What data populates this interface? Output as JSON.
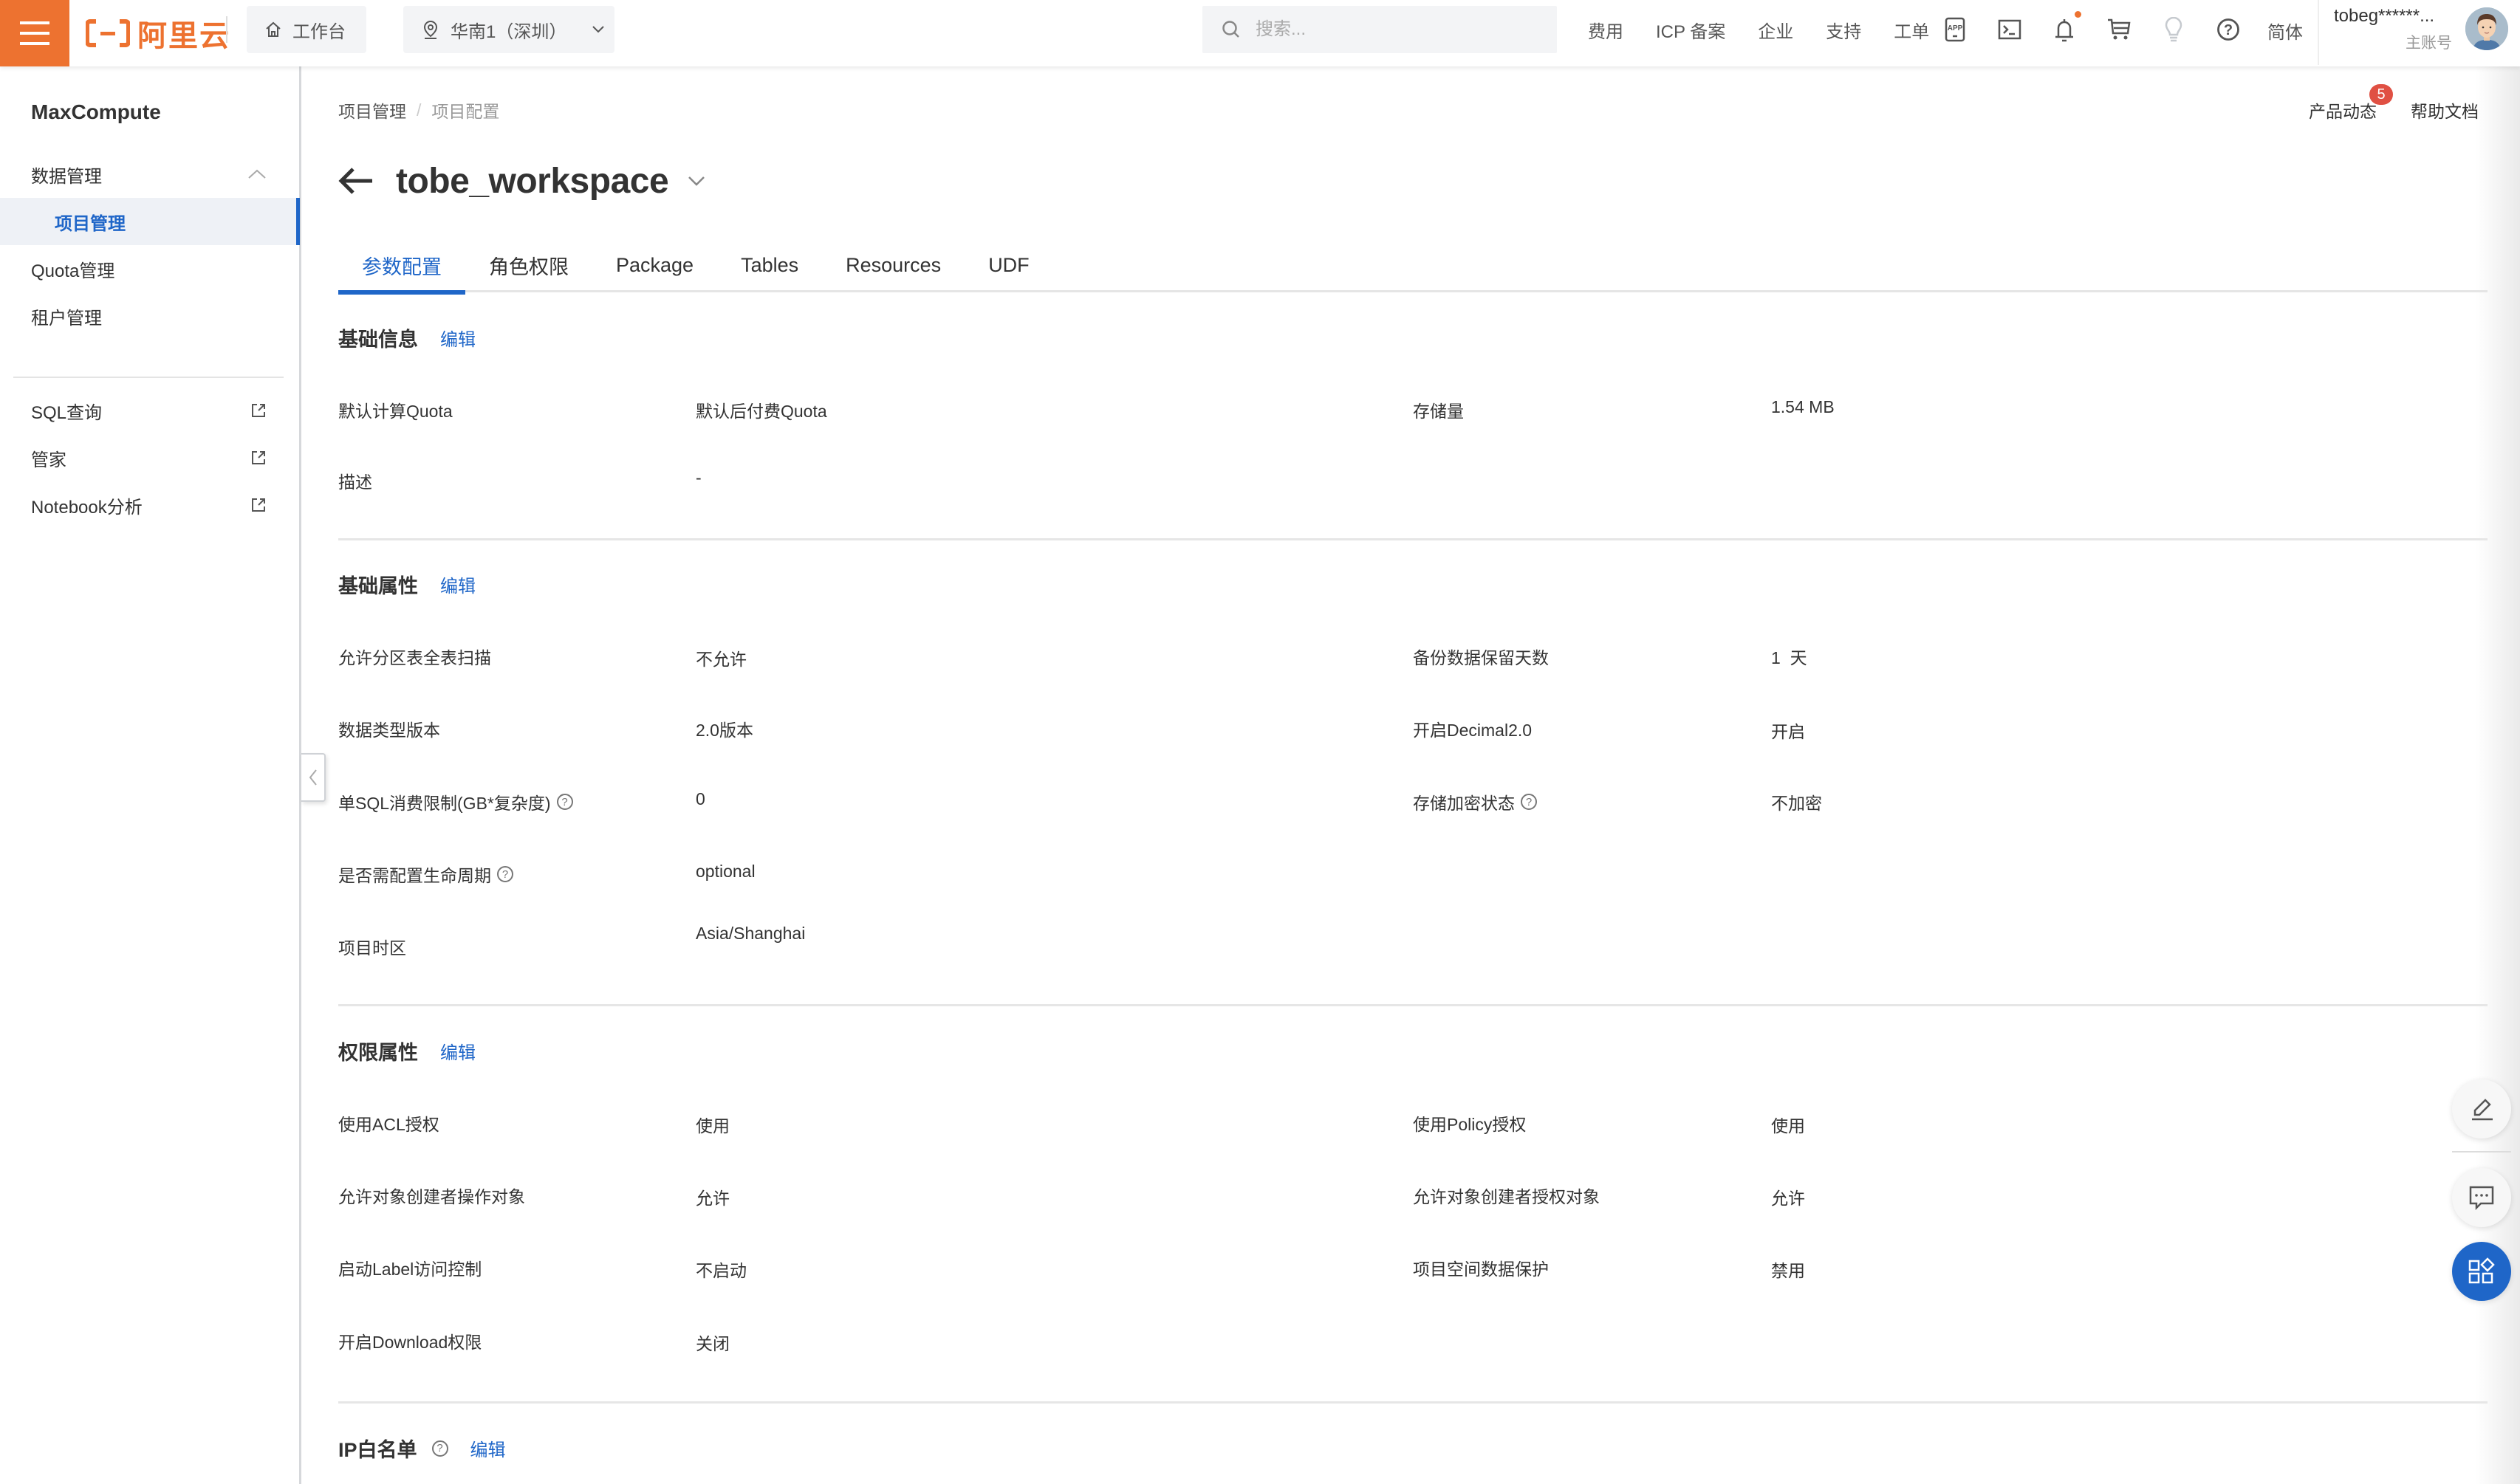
{
  "topbar": {
    "logo_text": "阿里云",
    "workbench_label": "工作台",
    "region_label": "华南1（深圳）",
    "search_placeholder": "搜索...",
    "nav_links": [
      "费用",
      "ICP 备案",
      "企业",
      "支持",
      "工单"
    ],
    "nav_icons": [
      "app-icon",
      "terminal-icon",
      "bell-icon",
      "cart-icon",
      "lightbulb-icon",
      "help-icon"
    ],
    "notification_dot": true,
    "language_label": "简体",
    "account_name": "tobeg******...",
    "account_role": "主账号",
    "brand_color": "#ED7230"
  },
  "sidebar": {
    "title": "MaxCompute",
    "groups": [
      {
        "label": "数据管理",
        "expanded": true,
        "children": [
          {
            "label": "项目管理",
            "active": true
          }
        ]
      },
      {
        "label": "Quota管理"
      },
      {
        "label": "租户管理"
      }
    ],
    "external_links": [
      {
        "label": "SQL查询"
      },
      {
        "label": "管家"
      },
      {
        "label": "Notebook分析"
      }
    ]
  },
  "breadcrumb": {
    "items": [
      "项目管理",
      "项目配置"
    ],
    "separator": "/"
  },
  "header_links": {
    "product_updates": "产品动态",
    "product_updates_badge": "5",
    "help_docs": "帮助文档"
  },
  "page": {
    "title": "tobe_workspace",
    "tabs": [
      {
        "label": "参数配置",
        "active": true
      },
      {
        "label": "角色权限"
      },
      {
        "label": "Package"
      },
      {
        "label": "Tables"
      },
      {
        "label": "Resources"
      },
      {
        "label": "UDF"
      }
    ],
    "accent_color": "#1F66C8"
  },
  "sections": {
    "basic_info": {
      "title": "基础信息",
      "edit_label": "编辑",
      "fields": {
        "default_quota": {
          "label": "默认计算Quota",
          "value": "默认后付费Quota"
        },
        "storage": {
          "label": "存储量",
          "value": "1.54 MB"
        },
        "description": {
          "label": "描述",
          "value": "-"
        }
      }
    },
    "basic_props": {
      "title": "基础属性",
      "edit_label": "编辑",
      "fields": {
        "full_scan": {
          "label": "允许分区表全表扫描",
          "value": "不允许"
        },
        "backup_days": {
          "label": "备份数据保留天数",
          "value": "1  天"
        },
        "type_version": {
          "label": "数据类型版本",
          "value": "2.0版本"
        },
        "decimal2": {
          "label": "开启Decimal2.0",
          "value": "开启"
        },
        "sql_cost_limit": {
          "label": "单SQL消费限制(GB*复杂度)",
          "value": "0",
          "has_help": true
        },
        "storage_encryption": {
          "label": "存储加密状态",
          "value": "不加密",
          "has_help": true
        },
        "lifecycle": {
          "label": "是否需配置生命周期",
          "value": "optional",
          "has_help": true
        },
        "timezone": {
          "label": "项目时区",
          "value": "Asia/Shanghai"
        }
      }
    },
    "permission_props": {
      "title": "权限属性",
      "edit_label": "编辑",
      "fields": {
        "acl": {
          "label": "使用ACL授权",
          "value": "使用"
        },
        "policy": {
          "label": "使用Policy授权",
          "value": "使用"
        },
        "creator_operate": {
          "label": "允许对象创建者操作对象",
          "value": "允许"
        },
        "creator_grant": {
          "label": "允许对象创建者授权对象",
          "value": "允许"
        },
        "label_access": {
          "label": "启动Label访问控制",
          "value": "不启动"
        },
        "data_protection": {
          "label": "项目空间数据保护",
          "value": "禁用"
        },
        "download": {
          "label": "开启Download权限",
          "value": "关闭"
        }
      }
    },
    "ip_whitelist": {
      "title": "IP白名单",
      "edit_label": "编辑",
      "has_help": true
    }
  },
  "floating_toolbar": [
    "edit-icon",
    "feedback-icon",
    "apps-icon"
  ]
}
